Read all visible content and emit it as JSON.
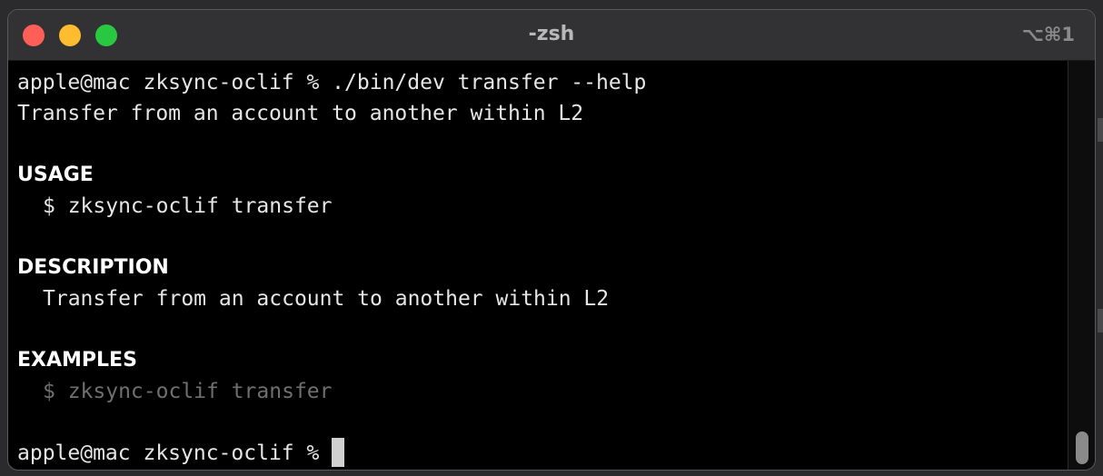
{
  "window": {
    "title": "-zsh",
    "shortcut": "⌥⌘1"
  },
  "colors": {
    "close": "#ff5f57",
    "minimize": "#febc2e",
    "zoom": "#28c840",
    "background": "#000000",
    "text": "#e6e6e6",
    "dim_text": "#6f6f6f"
  },
  "terminal": {
    "prompt_command": "apple@mac zksync-oclif % ./bin/dev transfer --help",
    "summary": "Transfer from an account to another within L2",
    "usage_heading": "USAGE",
    "usage_line": "$ zksync-oclif transfer",
    "description_heading": "DESCRIPTION",
    "description_line": "Transfer from an account to another within L2",
    "examples_heading": "EXAMPLES",
    "examples_line": "$ zksync-oclif transfer",
    "final_prompt": "apple@mac zksync-oclif %"
  }
}
